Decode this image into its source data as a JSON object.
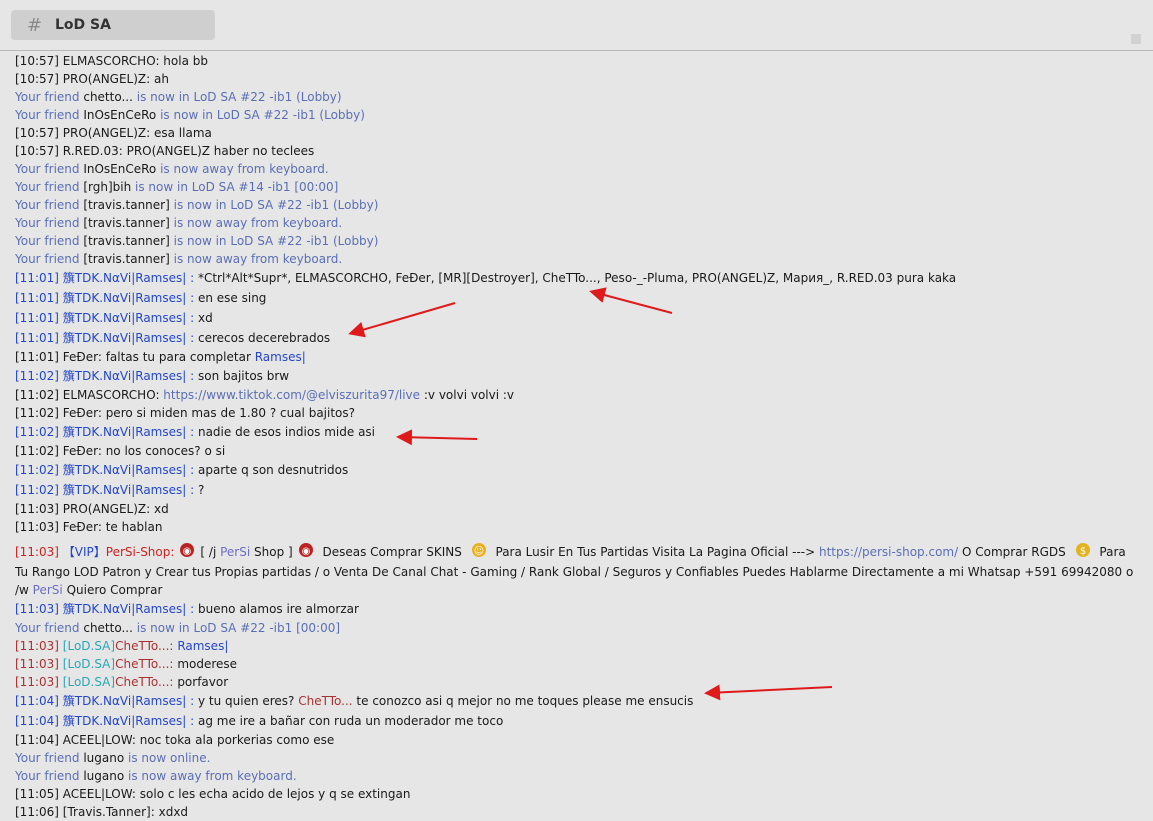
{
  "tab": {
    "icon": "hash-icon",
    "label": "LoD SA"
  },
  "lines": [
    {
      "ts": "[10:57]",
      "nick": "ELMASCORCHO",
      "msg": "hola bb"
    },
    {
      "ts": "[10:57]",
      "nick": "PRO(ANGEL)Z",
      "msg": "ah"
    },
    {
      "f1": "Your friend",
      "name": "chetto...",
      "f2": "is now in LoD SA #22 -ib1 (Lobby)"
    },
    {
      "f1": "Your friend",
      "name": "InOsEnCeRo",
      "f2": "is now in LoD SA #22 -ib1 (Lobby)"
    },
    {
      "ts": "[10:57]",
      "nick": "PRO(ANGEL)Z",
      "msg": "esa llama"
    },
    {
      "ts": "[10:57]",
      "nick": "R.RED.03",
      "msg": "PRO(ANGEL)Z haber no teclees"
    },
    {
      "f1": "Your friend",
      "name": "InOsEnCeRo",
      "f2": "is now away from keyboard."
    },
    {
      "f1": "Your friend",
      "name": "[rgh]bih",
      "f2": "is now in LoD SA #14 -ib1 [00:00]"
    },
    {
      "f1": "Your friend",
      "name": "[travis.tanner]",
      "f2": "is now in LoD SA #22 -ib1 (Lobby)"
    },
    {
      "f1": "Your friend",
      "name": "[travis.tanner]",
      "f2": "is now away from keyboard."
    },
    {
      "f1": "Your friend",
      "name": "[travis.tanner]",
      "f2": "is now in LoD SA #22 -ib1 (Lobby)"
    },
    {
      "f1": "Your friend",
      "name": "[travis.tanner]",
      "f2": "is now away from keyboard."
    },
    {
      "ts": "[11:01]",
      "nick": "籏TDK.NαVi|Ramses|",
      "msg": "*Ctrl*Alt*Supr*, ELMASCORCHO, FeĐer, [MR][Destroyer], CheTTo..., Peso-_-Pluma, PRO(ANGEL)Z, Мария_, ",
      "msg_bold": "R.RED.03",
      "msg_tail": " pura kaka"
    },
    {
      "ts": "[11:01]",
      "nick": "籏TDK.NαVi|Ramses|",
      "msg": "en ese sing"
    },
    {
      "ts": "[11:01]",
      "nick": "籏TDK.NαVi|Ramses|",
      "msg": "xd"
    },
    {
      "ts": "[11:01]",
      "nick": "籏TDK.NαVi|Ramses|",
      "msg": "cerecos decerebrados"
    },
    {
      "ts": "[11:01]",
      "nick": "FeĐer",
      "msg": "faltas tu para completar ",
      "mention": "Ramses|"
    },
    {
      "ts": "[11:02]",
      "nick": "籏TDK.NαVi|Ramses|",
      "msg": "son bajitos brw"
    },
    {
      "ts": "[11:02]",
      "nick": "ELMASCORCHO",
      "link": "https://www.tiktok.com/@elviszurita97/live",
      "msg": " :v volvi volvi :v"
    },
    {
      "ts": "[11:02]",
      "nick": "FeĐer",
      "msg": "pero si miden mas de 1.80 ? cual bajitos?"
    },
    {
      "ts": "[11:02]",
      "nick": "籏TDK.NαVi|Ramses|",
      "msg": "nadie de esos indios mide asi"
    },
    {
      "ts": "[11:02]",
      "nick": "FeĐer",
      "msg": "no los conoces? o si"
    },
    {
      "ts": "[11:02]",
      "nick": "籏TDK.NαVi|Ramses|",
      "msg": "aparte q son desnutridos"
    },
    {
      "ts": "[11:02]",
      "nick": "籏TDK.NαVi|Ramses|",
      "msg": "?"
    },
    {
      "ts": "[11:03]",
      "nick": "PRO(ANGEL)Z",
      "msg": "xd"
    },
    {
      "ts": "[11:03]",
      "nick": "FeĐer",
      "msg": "te hablan"
    }
  ],
  "vip": {
    "ts": "[11:03]",
    "tag": "【VIP】",
    "nick": "PerSi-Shop:",
    "p1": "[ /j ",
    "persi1": "PerSi",
    "p2": " Shop ]",
    "p3": " Deseas Comprar SKINS ",
    "p4": " Para Lusir En Tus Partidas Visita La Pagina Oficial ---> ",
    "link": "https://persi-shop.com/",
    "p5": " O Comprar RGDS ",
    "p6": " Para Tu Rango LOD Patron y Crear tus Propias partidas / o Venta De Canal Chat - Gaming / Rank Global / Seguros y Confiables Puedes Hablarme Directamente a mi Whatsap +591 69942080 o /w ",
    "persi2": "PerSi",
    "p7": " Quiero Comprar"
  },
  "lines2": [
    {
      "ts": "[11:03]",
      "nick": "籏TDK.NαVi|Ramses|",
      "msg": "bueno alamos ire almorzar"
    },
    {
      "f1": "Your friend",
      "name": "chetto...",
      "f2": "is now in LoD SA #22 -ib1 [00:00]"
    },
    {
      "ts": "[11:03]",
      "clan": "[LoD.SA]",
      "cnick": "CheTTo...:",
      "mention": "Ramses|"
    },
    {
      "ts": "[11:03]",
      "clan": "[LoD.SA]",
      "cnick": "CheTTo...:",
      "msg": "moderese"
    },
    {
      "ts": "[11:03]",
      "clan": "[LoD.SA]",
      "cnick": "CheTTo...:",
      "msg": "porfavor"
    },
    {
      "ts": "[11:04]",
      "nick": "籏TDK.NαVi|Ramses|",
      "msg": "y tu quien eres? ",
      "red": "CheTTo...",
      "msg_tail": " te conozco asi q mejor no me toques please me ensucis"
    },
    {
      "ts": "[11:04]",
      "nick": "籏TDK.NαVi|Ramses|",
      "msg": "ag me ire a bañar con ruda un moderador me toco"
    },
    {
      "ts": "[11:04]",
      "nick": "ACEEL|LOW",
      "msg": "noc toka ala porkerias como ese"
    },
    {
      "f1": "Your friend",
      "name": "lugano",
      "f2": "is now online."
    },
    {
      "f1": "Your friend",
      "name": "lugano",
      "f2": "is now away from keyboard."
    },
    {
      "ts": "[11:05]",
      "nick": "ACEEL|LOW",
      "msg": "solo c les echa acido de lejos y q se extingan"
    },
    {
      "ts": "[11:06]",
      "nick": "[Travis.Tanner]",
      "msg": "xdxd"
    }
  ],
  "colors": {
    "friend": "#5a6fb5",
    "ramses": "#2347c8",
    "vip": "#cc2222",
    "clan": "#2ba7b8",
    "chetto": "#a83232",
    "arrow": "#e0191b"
  }
}
